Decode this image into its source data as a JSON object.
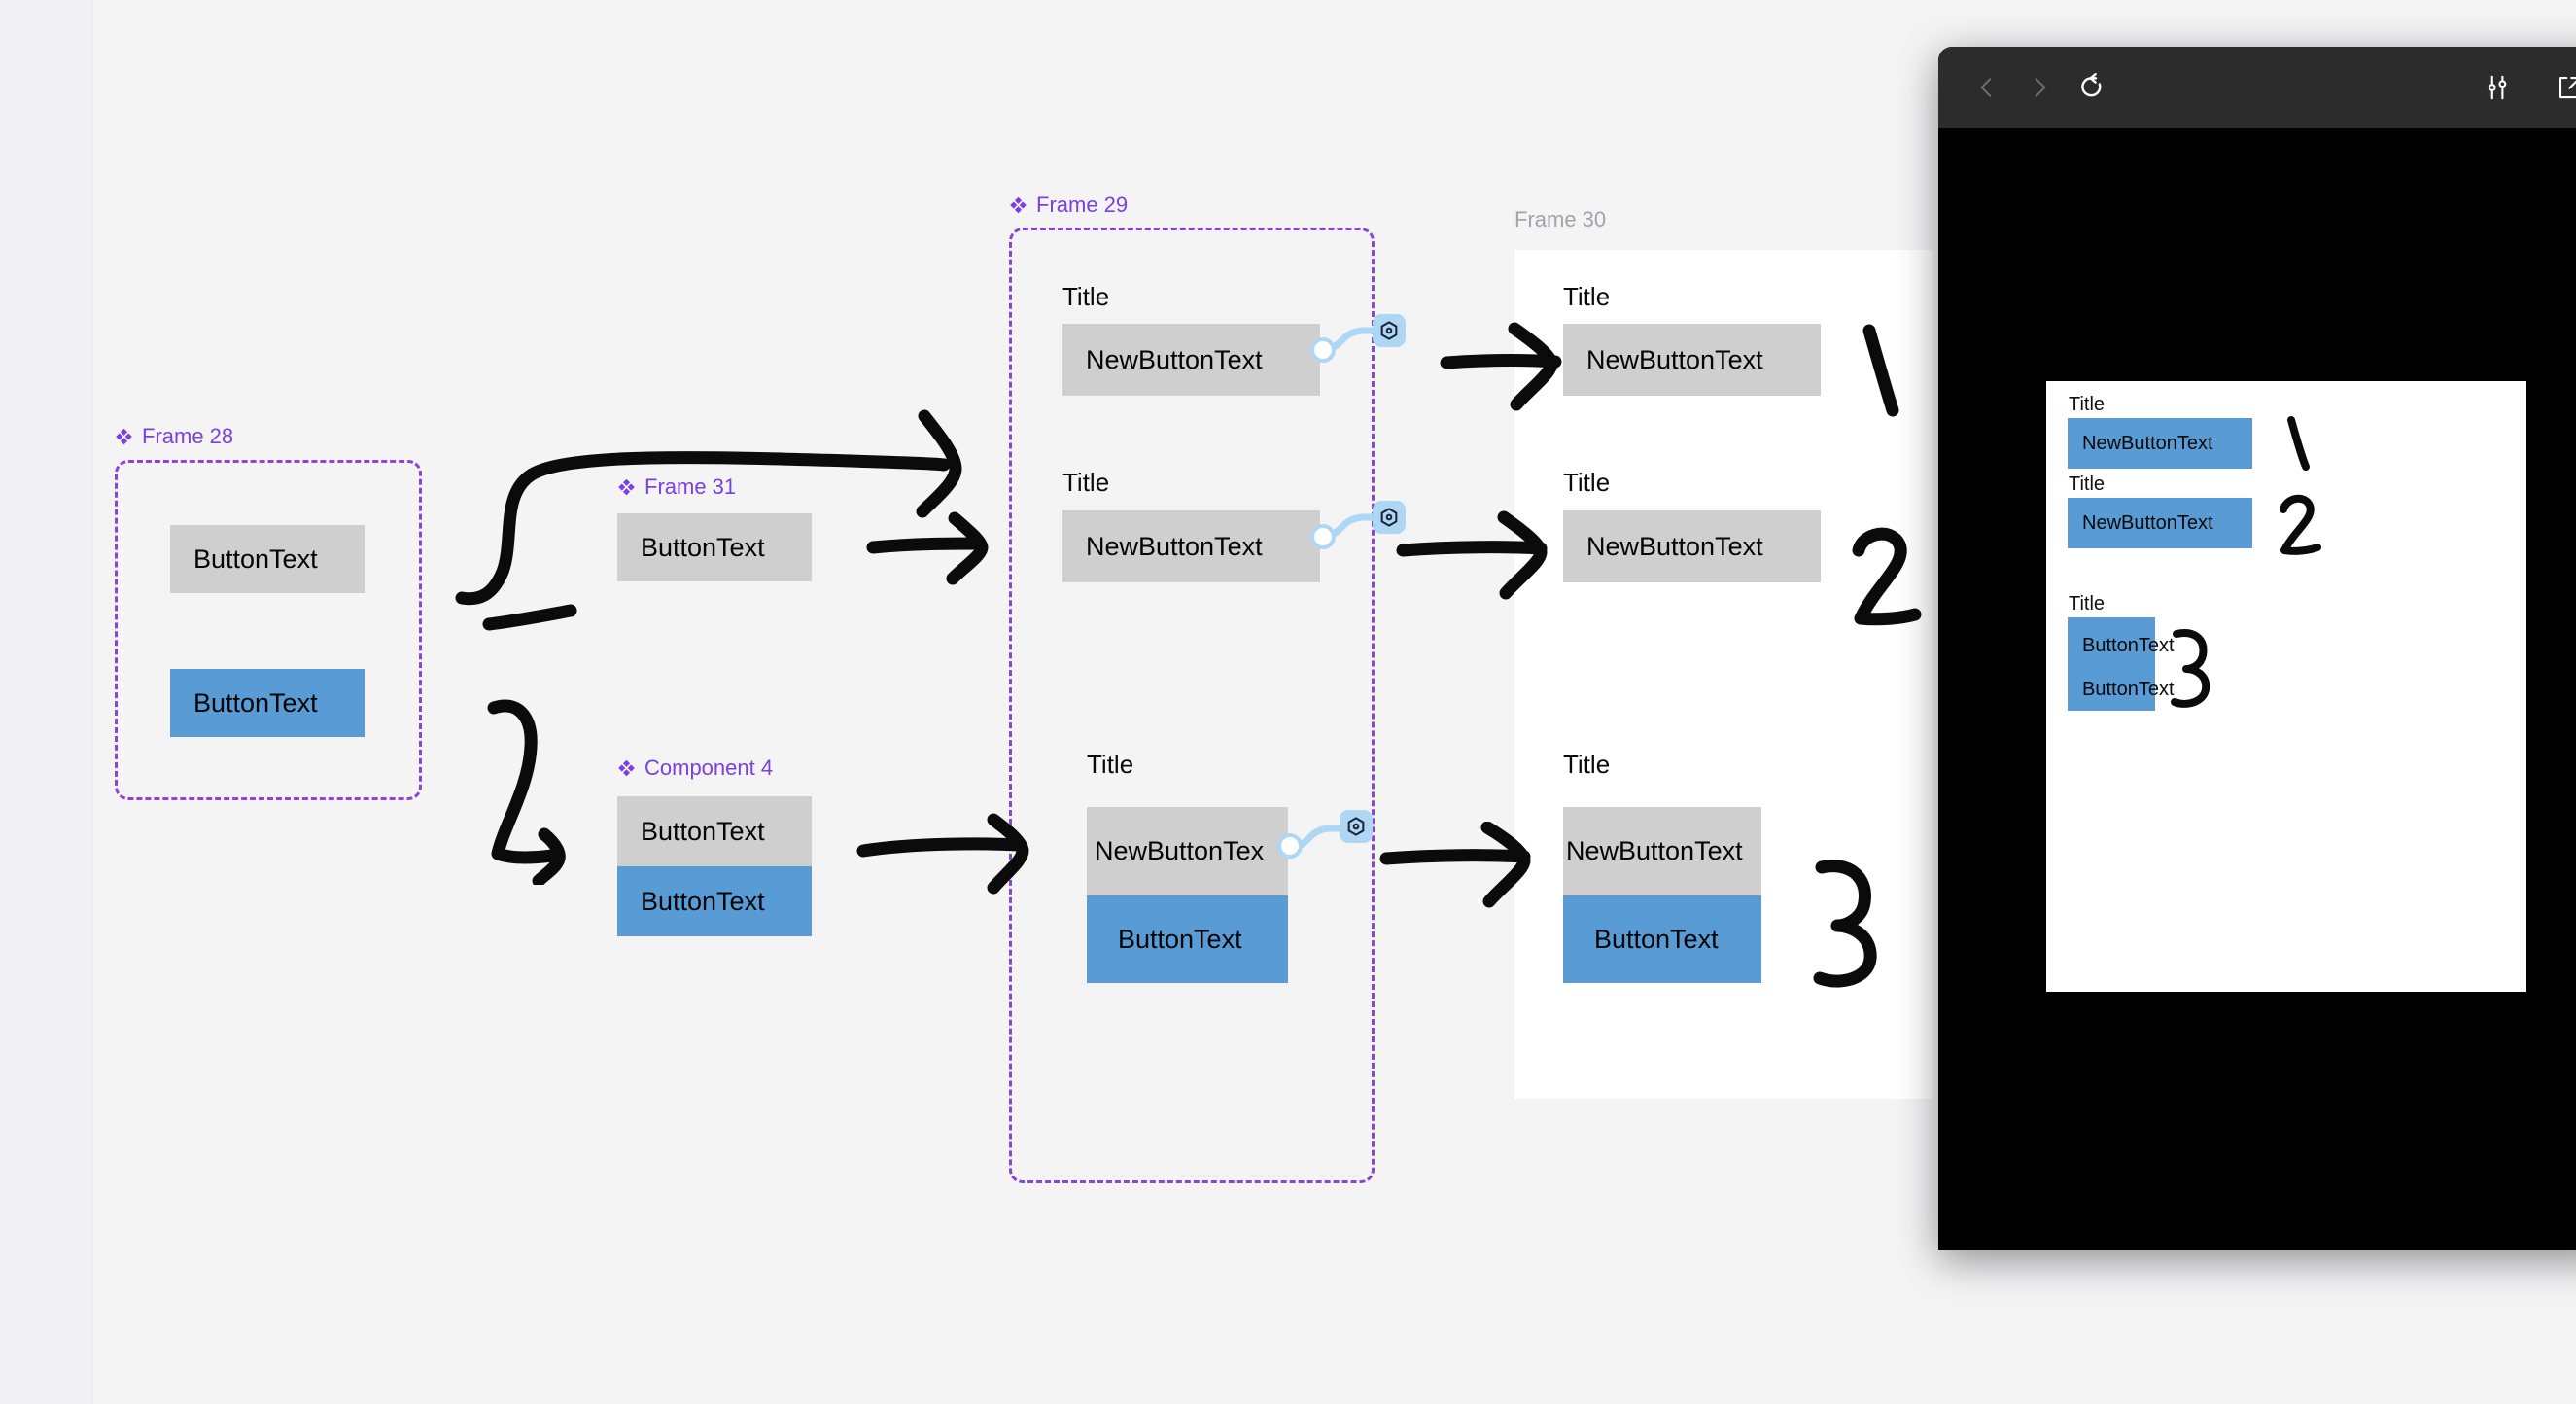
{
  "canvas": {
    "frames": [
      {
        "id": "frame28",
        "label": "Frame 28",
        "kind": "component"
      },
      {
        "id": "frame31",
        "label": "Frame 31",
        "kind": "component"
      },
      {
        "id": "component4",
        "label": "Component 4",
        "kind": "component"
      },
      {
        "id": "frame29",
        "label": "Frame 29",
        "kind": "component"
      },
      {
        "id": "frame30",
        "label": "Frame 30",
        "kind": "plain"
      }
    ],
    "frame28": {
      "label": "Frame 28",
      "buttons": [
        {
          "text": "ButtonText",
          "variant": "grey"
        },
        {
          "text": "ButtonText",
          "variant": "blue"
        }
      ]
    },
    "frame31": {
      "label": "Frame 31",
      "buttons": [
        {
          "text": "ButtonText",
          "variant": "grey"
        }
      ]
    },
    "component4": {
      "label": "Component 4",
      "buttons": [
        {
          "text": "ButtonText",
          "variant": "grey"
        },
        {
          "text": "ButtonText",
          "variant": "blue"
        }
      ]
    },
    "frame29": {
      "label": "Frame 29",
      "cards": [
        {
          "title": "Title",
          "buttons": [
            {
              "text": "NewButtonText",
              "variant": "grey"
            }
          ]
        },
        {
          "title": "Title",
          "buttons": [
            {
              "text": "NewButtonText",
              "variant": "grey"
            }
          ]
        },
        {
          "title": "Title",
          "buttons": [
            {
              "text": "NewButtonTex",
              "variant": "grey"
            },
            {
              "text": "ButtonText",
              "variant": "blue"
            }
          ]
        }
      ]
    },
    "frame30": {
      "label": "Frame 30",
      "cards": [
        {
          "title": "Title",
          "buttons": [
            {
              "text": "NewButtonText",
              "variant": "grey"
            }
          ]
        },
        {
          "title": "Title",
          "buttons": [
            {
              "text": "NewButtonText",
              "variant": "grey"
            }
          ]
        },
        {
          "title": "Title",
          "buttons": [
            {
              "text": "NewButtonText",
              "variant": "grey"
            },
            {
              "text": "ButtonText",
              "variant": "blue"
            }
          ]
        }
      ]
    },
    "annotations": [
      {
        "mark": "1"
      },
      {
        "mark": "2"
      },
      {
        "mark": "3"
      }
    ]
  },
  "preview": {
    "toolbar": {
      "back_icon": "chevron-left-icon",
      "forward_icon": "chevron-right-icon",
      "restart_icon": "restart-icon",
      "settings_icon": "sliders-icon",
      "open_external_icon": "external-link-icon"
    },
    "page": {
      "sections": [
        {
          "title": "Title",
          "buttons": [
            {
              "text": "NewButtonText"
            }
          ],
          "mark": "1"
        },
        {
          "title": "Title",
          "buttons": [
            {
              "text": "NewButtonText"
            }
          ],
          "mark": "2"
        },
        {
          "title": "Title",
          "buttons": [
            {
              "text": "ButtonText"
            },
            {
              "text": "ButtonText"
            }
          ],
          "mark": "3"
        }
      ]
    }
  },
  "colors": {
    "frame_label_purple": "#7b3fe4",
    "frame_label_grey": "#a3a3a8",
    "dashed_border": "#8b44d6",
    "button_grey": "#cfcfcf",
    "button_blue": "#599bd5",
    "canvas_bg": "#f4f4f5",
    "connector_blue": "#aed6f5",
    "panel_black": "#000000",
    "toolbar_dark": "#2c2c2c"
  }
}
